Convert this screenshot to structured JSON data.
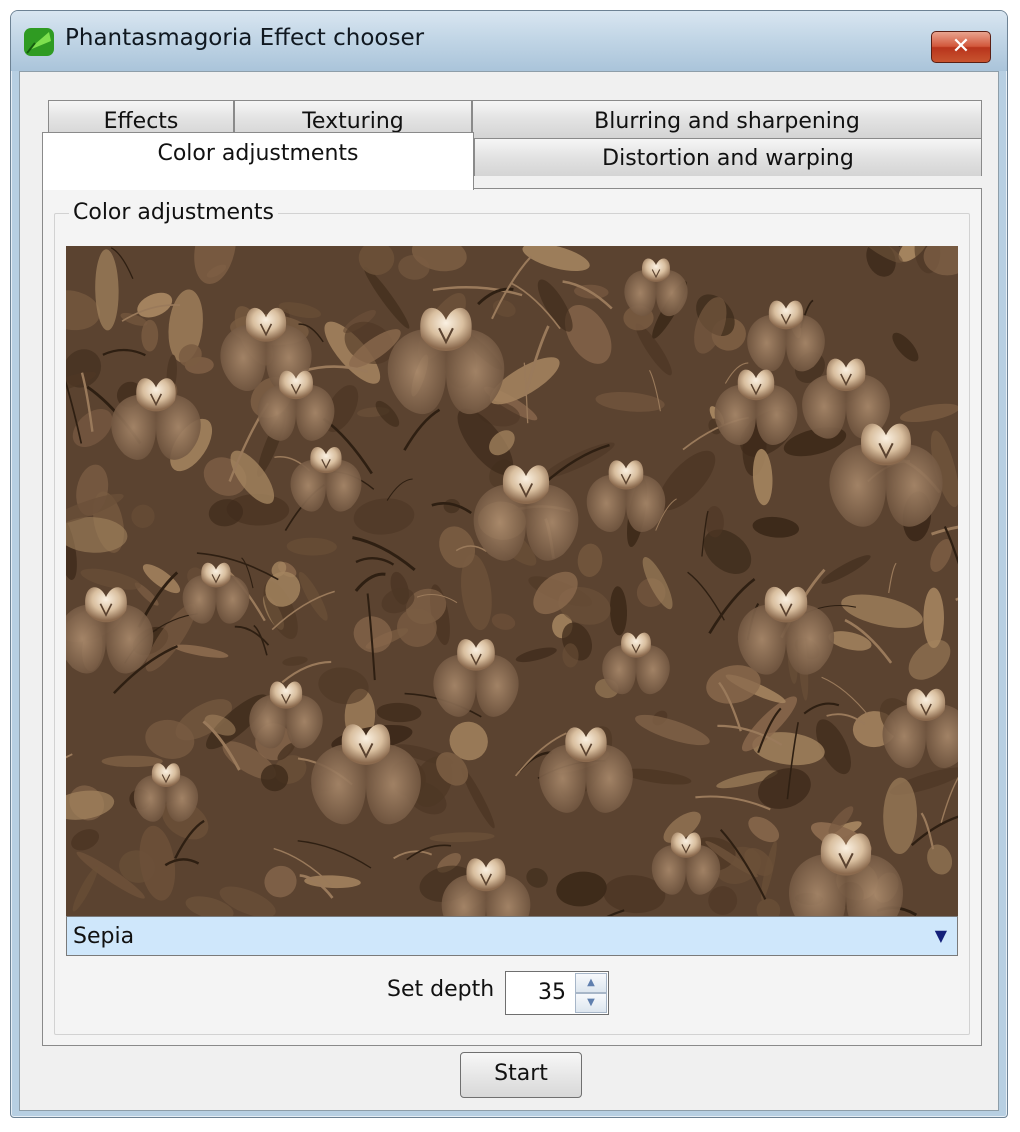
{
  "window": {
    "title": "Phantasmagoria Effect chooser",
    "close_label": "✕"
  },
  "tabs": [
    {
      "label": "Effects",
      "active": false
    },
    {
      "label": "Texturing",
      "active": false
    },
    {
      "label": "Blurring and sharpening",
      "active": false
    },
    {
      "label": "Color adjustments",
      "active": true
    },
    {
      "label": "Distortion and warping",
      "active": false
    }
  ],
  "group": {
    "label": "Color adjustments"
  },
  "effect": {
    "selected": "Sepia",
    "depth_label": "Set depth",
    "depth_value": "35"
  },
  "actions": {
    "start_label": "Start"
  },
  "colors": {
    "sepia_dark": "#3d2a1a",
    "sepia_mid": "#8b6a4e",
    "sepia_light": "#e8d6bf",
    "combo_selected_bg": "#cfe7fb"
  },
  "icons": {
    "app": "leaf-icon",
    "close": "close-icon",
    "dropdown": "chevron-down-icon",
    "spin_up": "spin-up-icon",
    "spin_down": "spin-down-icon"
  }
}
